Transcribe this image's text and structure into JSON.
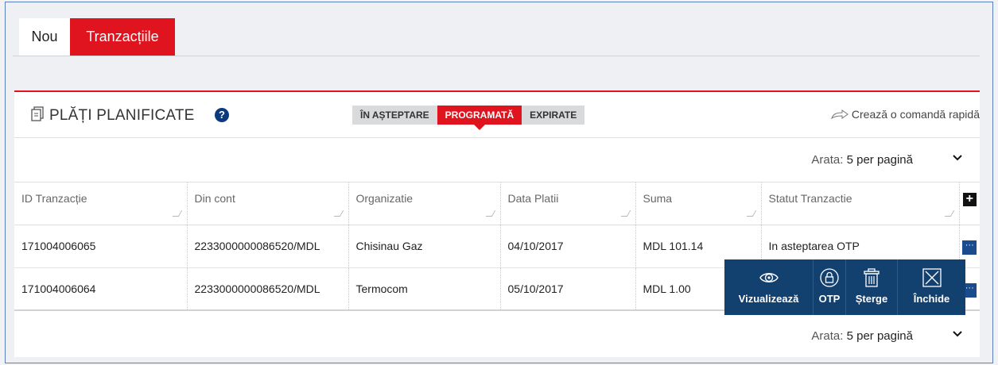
{
  "tabs": {
    "new": "Nou",
    "transactions": "Tranzacțiile"
  },
  "panel": {
    "title": "PLĂȚI PLANIFICATE",
    "help": "?",
    "filters": [
      "ÎN AȘTEPTARE",
      "PROGRAMATĂ",
      "EXPIRATE"
    ],
    "active_filter": "PROGRAMATĂ",
    "quick_order": "Crează o comandă rapidă"
  },
  "pager": {
    "label": "Arata:",
    "value": "5 per pagină"
  },
  "table": {
    "columns": [
      "ID Tranzacție",
      "Din cont",
      "Organizatie",
      "Data Platii",
      "Suma",
      "Statut Tranzactie"
    ],
    "rows": [
      {
        "id": "171004006065",
        "account": "2233000000086520/MDL",
        "org": "Chisinau Gaz",
        "date": "04/10/2017",
        "amount": "MDL 101.14",
        "status": "In asteptarea OTP"
      },
      {
        "id": "171004006064",
        "account": "2233000000086520/MDL",
        "org": "Termocom",
        "date": "05/10/2017",
        "amount": "MDL 1.00",
        "status": ""
      }
    ]
  },
  "context_menu": {
    "view": "Vizualizează",
    "otp": "OTP",
    "delete": "Șterge",
    "close": "Închide"
  },
  "colors": {
    "accent": "#e0141e",
    "menu_bg": "#12406f",
    "help_bg": "#0a3c7d"
  }
}
